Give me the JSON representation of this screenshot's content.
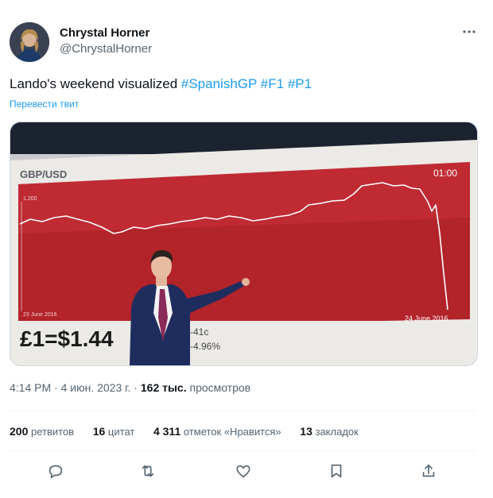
{
  "author": {
    "display_name": "Chrystal Horner",
    "handle": "@ChrystalHorner"
  },
  "tweet": {
    "text_prefix": "Lando's weekend visualized ",
    "hashtags": [
      "#SpanishGP",
      "#F1",
      "#P1"
    ],
    "translate_label": "Перевести твит"
  },
  "media": {
    "chart_title": "GBP/USD",
    "time_label": "01:00",
    "y_tick": "1.200",
    "start_date": "23 June 2016",
    "end_date": "24 June 2016",
    "rate_text": "£1=$1.44",
    "change_text": "-41c",
    "percent_text": "-4.96%",
    "colors": {
      "panel": "#c1272d",
      "line": "#ffffff"
    }
  },
  "meta": {
    "time": "4:14 PM",
    "separator": " · ",
    "date": "4 июн. 2023 г.",
    "views_count": "162 тыс.",
    "views_label": "просмотров"
  },
  "stats": {
    "retweets_count": "200",
    "retweets_label": "ретвитов",
    "quotes_count": "16",
    "quotes_label": "цитат",
    "likes_count": "4 311",
    "likes_label": "отметок «Нравится»",
    "bookmarks_count": "13",
    "bookmarks_label": "закладок"
  },
  "icons": [
    "more-icon",
    "reply-icon",
    "retweet-icon",
    "like-icon",
    "bookmark-icon",
    "share-icon"
  ]
}
